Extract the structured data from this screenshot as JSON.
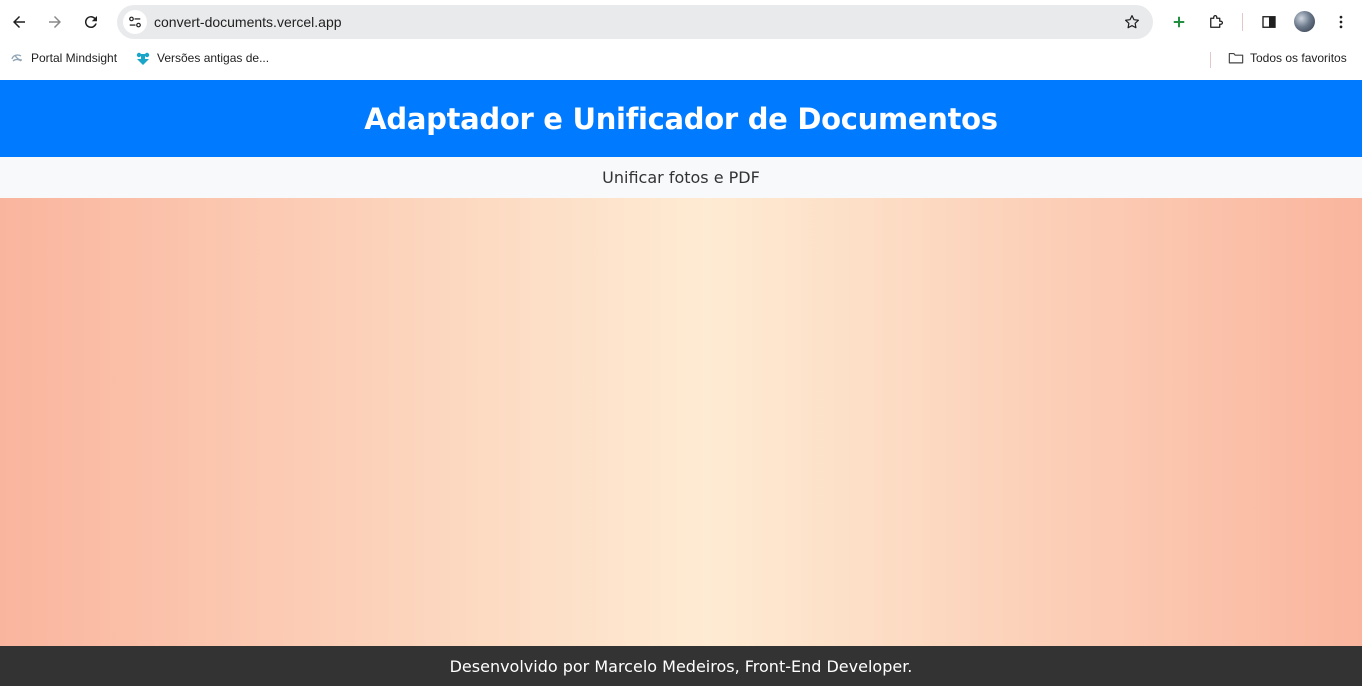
{
  "browser": {
    "url": "convert-documents.vercel.app",
    "bookmarks": [
      {
        "label": "Portal Mindsight",
        "icon": "mindsight-icon"
      },
      {
        "label": "Versões antigas de...",
        "icon": "versions-icon"
      }
    ],
    "all_bookmarks_label": "Todos os favoritos",
    "colors": {
      "toolbar": "#ffffff",
      "omnibox": "#e9eaec",
      "add_icon": "#1e8e3e"
    }
  },
  "page": {
    "title": "Adaptador e Unificador de Documentos",
    "nav": {
      "link_label": "Unificar fotos e PDF"
    },
    "footer": {
      "text": "Desenvolvido por Marcelo Medeiros, Front-End Developer."
    },
    "colors": {
      "header": "#007bff",
      "nav": "#f7f9fb",
      "footer": "#333333",
      "gradient_edge": "#fab59e",
      "gradient_center": "#feebd3"
    }
  }
}
